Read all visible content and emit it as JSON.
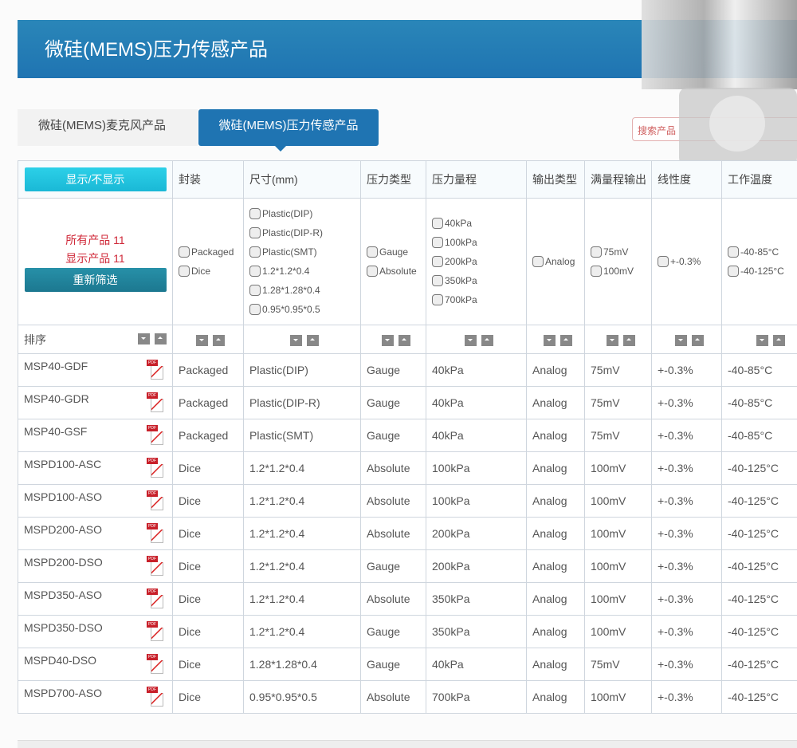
{
  "banner": {
    "title": "微硅(MEMS)压力传感产品"
  },
  "tabs": [
    {
      "label": "微硅(MEMS)麦克风产品"
    },
    {
      "label": "微硅(MEMS)压力传感产品"
    }
  ],
  "search": {
    "placeholder": "搜索产品"
  },
  "table": {
    "toggle_label": "显示/不显示",
    "headers": [
      "封装",
      "尺寸(mm)",
      "压力类型",
      "压力量程",
      "输出类型",
      "满量程输出",
      "线性度",
      "工作温度"
    ],
    "all_products": "所有产品 11",
    "shown_products": "显示产品 11",
    "refilter_label": "重新筛选",
    "sort_label": "排序",
    "filters": [
      [
        "Packaged",
        "Dice"
      ],
      [
        "Plastic(DIP)",
        "Plastic(DIP-R)",
        "Plastic(SMT)",
        "1.2*1.2*0.4",
        "1.28*1.28*0.4",
        "0.95*0.95*0.5"
      ],
      [
        "Gauge",
        "Absolute"
      ],
      [
        "40kPa",
        "100kPa",
        "200kPa",
        "350kPa",
        "700kPa"
      ],
      [
        "Analog"
      ],
      [
        "75mV",
        "100mV"
      ],
      [
        "+-0.3%"
      ],
      [
        "-40-85°C",
        "-40-125°C"
      ]
    ],
    "rows": [
      [
        "MSP40-GDF",
        "Packaged",
        "Plastic(DIP)",
        "Gauge",
        "40kPa",
        "Analog",
        "75mV",
        "+-0.3%",
        "-40-85°C"
      ],
      [
        "MSP40-GDR",
        "Packaged",
        "Plastic(DIP-R)",
        "Gauge",
        "40kPa",
        "Analog",
        "75mV",
        "+-0.3%",
        "-40-85°C"
      ],
      [
        "MSP40-GSF",
        "Packaged",
        "Plastic(SMT)",
        "Gauge",
        "40kPa",
        "Analog",
        "75mV",
        "+-0.3%",
        "-40-85°C"
      ],
      [
        "MSPD100-ASC",
        "Dice",
        "1.2*1.2*0.4",
        "Absolute",
        "100kPa",
        "Analog",
        "100mV",
        "+-0.3%",
        "-40-125°C"
      ],
      [
        "MSPD100-ASO",
        "Dice",
        "1.2*1.2*0.4",
        "Absolute",
        "100kPa",
        "Analog",
        "100mV",
        "+-0.3%",
        "-40-125°C"
      ],
      [
        "MSPD200-ASO",
        "Dice",
        "1.2*1.2*0.4",
        "Absolute",
        "200kPa",
        "Analog",
        "100mV",
        "+-0.3%",
        "-40-125°C"
      ],
      [
        "MSPD200-DSO",
        "Dice",
        "1.2*1.2*0.4",
        "Gauge",
        "200kPa",
        "Analog",
        "100mV",
        "+-0.3%",
        "-40-125°C"
      ],
      [
        "MSPD350-ASO",
        "Dice",
        "1.2*1.2*0.4",
        "Absolute",
        "350kPa",
        "Analog",
        "100mV",
        "+-0.3%",
        "-40-125°C"
      ],
      [
        "MSPD350-DSO",
        "Dice",
        "1.2*1.2*0.4",
        "Gauge",
        "350kPa",
        "Analog",
        "100mV",
        "+-0.3%",
        "-40-125°C"
      ],
      [
        "MSPD40-DSO",
        "Dice",
        "1.28*1.28*0.4",
        "Gauge",
        "40kPa",
        "Analog",
        "75mV",
        "+-0.3%",
        "-40-125°C"
      ],
      [
        "MSPD700-ASO",
        "Dice",
        "0.95*0.95*0.5",
        "Absolute",
        "700kPa",
        "Analog",
        "100mV",
        "+-0.3%",
        "-40-125°C"
      ]
    ]
  }
}
